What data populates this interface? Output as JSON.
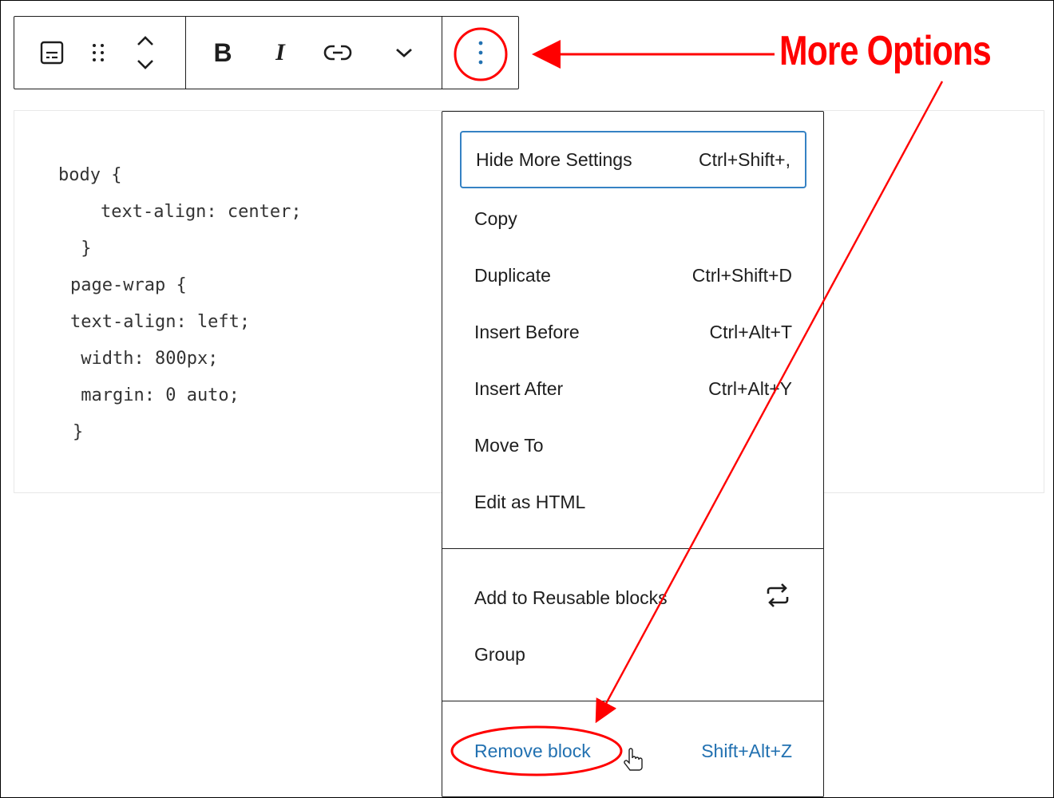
{
  "toolbar": {
    "buttons": [
      {
        "name": "block-type",
        "icon": "code-block-icon"
      },
      {
        "name": "drag",
        "icon": "drag-handle-icon"
      },
      {
        "name": "move",
        "icon": "chevron-up-down-icon"
      },
      {
        "name": "bold",
        "label": "B",
        "icon": "bold-icon"
      },
      {
        "name": "italic",
        "label": "I",
        "icon": "italic-icon"
      },
      {
        "name": "link",
        "icon": "link-icon"
      },
      {
        "name": "more-rich-text",
        "icon": "chevron-down-icon"
      },
      {
        "name": "more-options",
        "icon": "vertical-ellipsis-icon"
      }
    ]
  },
  "code": {
    "lines": [
      "body {",
      "    text-align: center;",
      " }",
      "page-wrap {",
      "text-align: left;",
      " width: 800px;",
      " margin: 0 auto;",
      "}"
    ]
  },
  "menu": {
    "items": [
      {
        "label": "Hide More Settings",
        "shortcut": "Ctrl+Shift+,"
      },
      {
        "label": "Copy",
        "shortcut": ""
      },
      {
        "label": "Duplicate",
        "shortcut": "Ctrl+Shift+D"
      },
      {
        "label": "Insert Before",
        "shortcut": "Ctrl+Alt+T"
      },
      {
        "label": "Insert After",
        "shortcut": "Ctrl+Alt+Y"
      },
      {
        "label": "Move To",
        "shortcut": ""
      },
      {
        "label": "Edit as HTML",
        "shortcut": ""
      },
      {
        "label": "Add to Reusable blocks",
        "shortcut": "",
        "icon": "reusable-block-icon"
      },
      {
        "label": "Group",
        "shortcut": ""
      },
      {
        "label": "Remove block",
        "shortcut": "Shift+Alt+Z"
      }
    ]
  },
  "annotation": {
    "label": "More Options",
    "color": "#ff0000"
  },
  "colors": {
    "accent": "#2271b1",
    "focus": "#3582c4"
  }
}
